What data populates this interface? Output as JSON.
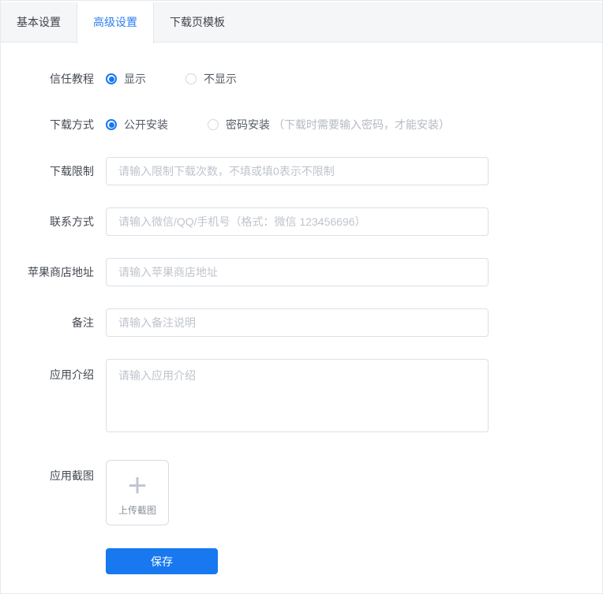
{
  "tabs": [
    {
      "label": "基本设置",
      "active": false
    },
    {
      "label": "高级设置",
      "active": true
    },
    {
      "label": "下载页模板",
      "active": false
    }
  ],
  "form": {
    "trust_tutorial": {
      "label": "信任教程",
      "options": [
        {
          "label": "显示",
          "selected": true
        },
        {
          "label": "不显示",
          "selected": false
        }
      ]
    },
    "download_method": {
      "label": "下载方式",
      "options": [
        {
          "label": "公开安装",
          "selected": true
        },
        {
          "label": "密码安装",
          "selected": false,
          "note": "（下载时需要输入密码，才能安装）"
        }
      ]
    },
    "download_limit": {
      "label": "下载限制",
      "value": "",
      "placeholder": "请输入限制下载次数，不填或填0表示不限制"
    },
    "contact": {
      "label": "联系方式",
      "value": "",
      "placeholder": "请输入微信/QQ/手机号（格式：微信 123456696）"
    },
    "apple_store": {
      "label": "苹果商店地址",
      "value": "",
      "placeholder": "请输入苹果商店地址"
    },
    "remark": {
      "label": "备注",
      "value": "",
      "placeholder": "请输入备注说明"
    },
    "app_intro": {
      "label": "应用介绍",
      "value": "",
      "placeholder": "请输入应用介绍"
    },
    "app_screenshot": {
      "label": "应用截图",
      "plus_icon": "+",
      "upload_text": "上传截图"
    },
    "save_label": "保存"
  },
  "colors": {
    "accent": "#1778f0",
    "tab_active_text": "#2d7ff0",
    "tab_bar_bg": "#f5f6f7",
    "border": "#e4e7ed",
    "input_border": "#dcdfe6",
    "placeholder": "#bfc4cc",
    "label_text": "#444950",
    "note_text": "#b6bac2"
  }
}
